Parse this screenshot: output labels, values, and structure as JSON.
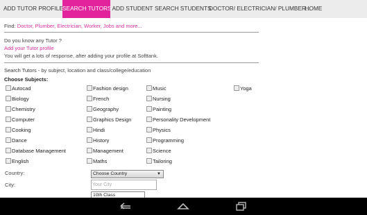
{
  "nav": {
    "tabs": [
      {
        "label": "ADD TUTOR PROFILE"
      },
      {
        "label": "SEARCH TUTORS"
      },
      {
        "label": "ADD STUDENT"
      },
      {
        "label": "SEARCH STUDENTS"
      },
      {
        "label": "DOCTOR/ ELECTRICIAN/ PLUMBER..."
      },
      {
        "label": "HOME"
      }
    ],
    "active_color": "#e2249c"
  },
  "find": {
    "label": "Find:",
    "link": "Doctor, Plumber, Electrician, Worker, Jobs and more..."
  },
  "promo": {
    "question": "Do you know any Tutor ?",
    "link": "Add your Tutor profile",
    "note": "You will get a lots of response, after adding your profile at Softtank."
  },
  "search": {
    "heading": "Search Tutors",
    "subheading": " - by subject, location and class/college/education",
    "choose_label": "Choose Subjects:"
  },
  "subjects": {
    "col1": [
      "Autocad",
      "Biology",
      "Chemistry",
      "Computer",
      "Cooking",
      "Dance",
      "Database Management",
      "English"
    ],
    "col2": [
      "Fashion design",
      "French",
      "Geography",
      "Graphics Design",
      "Hindi",
      "History",
      "Management",
      "Maths"
    ],
    "col3": [
      "Music",
      "Nursing",
      "Painting",
      "Personality Development",
      "Physics",
      "Programming",
      "Science",
      "Tailoring"
    ],
    "col4": [
      "Yoga"
    ]
  },
  "form": {
    "country_label": "Country:",
    "country_value": "Choose Country",
    "city_label": "City:",
    "city_placeholder": "Your City",
    "class_value": "10th Class"
  },
  "system_bar": {
    "icons": [
      "back-icon",
      "home-icon",
      "recent-apps-icon"
    ]
  }
}
